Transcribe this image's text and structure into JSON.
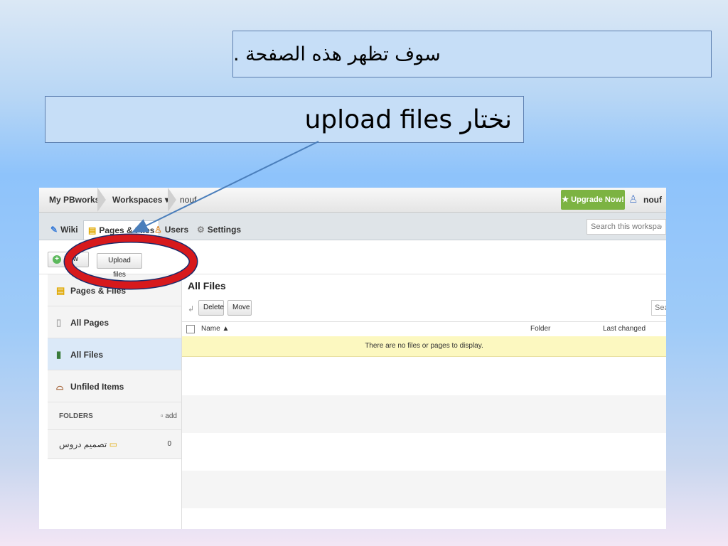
{
  "slide": {
    "callout_top": "سوف تظهر هذه الصفحة .",
    "callout_instruction": "upload files نختار"
  },
  "topbar": {
    "crumbs": [
      "My PBworks",
      "Workspaces ▾",
      "nouf"
    ],
    "upgrade_label": "Upgrade Now!",
    "user_name": "nouf"
  },
  "tabs": [
    {
      "label": "Wiki",
      "icon": "wiki-icon"
    },
    {
      "label": "Pages & Files",
      "icon": "pages-files-icon"
    },
    {
      "label": "Users",
      "icon": "users-icon"
    },
    {
      "label": "Settings",
      "icon": "settings-icon"
    }
  ],
  "search": {
    "workspace_placeholder": "Search this workspace",
    "files_placeholder": "Sea"
  },
  "actions": {
    "new_label": "New",
    "upload_label": "Upload files"
  },
  "sidebar": {
    "items": [
      {
        "label": "Pages & Files",
        "icon": "pages-files-icon"
      },
      {
        "label": "All Pages",
        "icon": "all-pages-icon"
      },
      {
        "label": "All Files",
        "icon": "all-files-icon"
      },
      {
        "label": "Unfiled Items",
        "icon": "unfiled-icon"
      }
    ],
    "folders_heading": "FOLDERS",
    "folders_add": "add",
    "folder": {
      "name": "تصميم دروس",
      "count": "0"
    }
  },
  "main": {
    "title": "All Files",
    "delete_label": "Delete",
    "move_label": "Move",
    "columns": {
      "name": "Name ▲",
      "folder": "Folder",
      "changed": "Last changed"
    },
    "empty_message": "There are no files or pages to display."
  },
  "colors": {
    "accent_red": "#d7191c",
    "arrow_blue": "#4a7ebb",
    "upgrade_green": "#7cb342"
  }
}
